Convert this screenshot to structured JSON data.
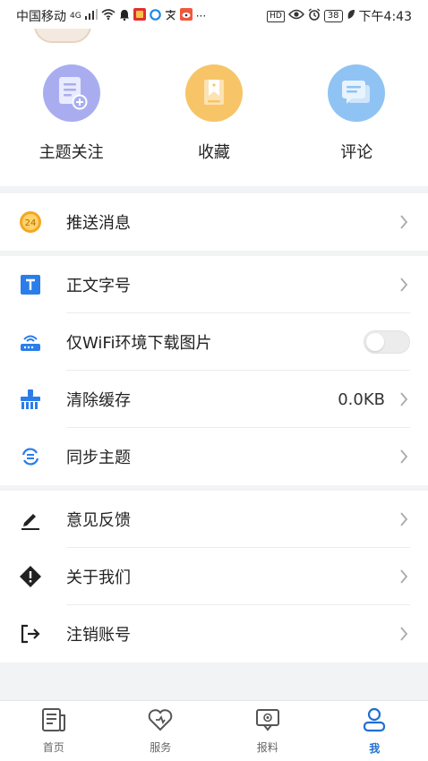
{
  "status_bar": {
    "carrier": "中国移动",
    "network": "4G",
    "battery": "38",
    "time": "下午4:43",
    "hd": "HD",
    "more": "···"
  },
  "quick_actions": [
    {
      "label": "主题关注",
      "icon": "doc-add-icon",
      "color": "#a9adf0"
    },
    {
      "label": "收藏",
      "icon": "bookmark-icon",
      "color": "#f7c567"
    },
    {
      "label": "评论",
      "icon": "chat-icon",
      "color": "#8fc3f3"
    }
  ],
  "settings": {
    "push": {
      "label": "推送消息",
      "icon": "push-24-icon"
    },
    "font_size": {
      "label": "正文字号",
      "icon": "text-icon"
    },
    "wifi_images": {
      "label": "仅WiFi环境下载图片",
      "icon": "router-icon",
      "enabled": false
    },
    "clear_cache": {
      "label": "清除缓存",
      "value": "0.0KB",
      "icon": "broom-icon"
    },
    "sync_theme": {
      "label": "同步主题",
      "icon": "sync-icon"
    },
    "feedback": {
      "label": "意见反馈",
      "icon": "pen-icon"
    },
    "about": {
      "label": "关于我们",
      "icon": "alert-diamond-icon"
    },
    "logout": {
      "label": "注销账号",
      "icon": "logout-icon"
    }
  },
  "nav": {
    "items": [
      {
        "label": "首页",
        "icon": "news-icon"
      },
      {
        "label": "服务",
        "icon": "heart-icon"
      },
      {
        "label": "报料",
        "icon": "report-icon"
      },
      {
        "label": "我",
        "icon": "person-icon"
      }
    ],
    "active_color": "#1f6fd1"
  }
}
